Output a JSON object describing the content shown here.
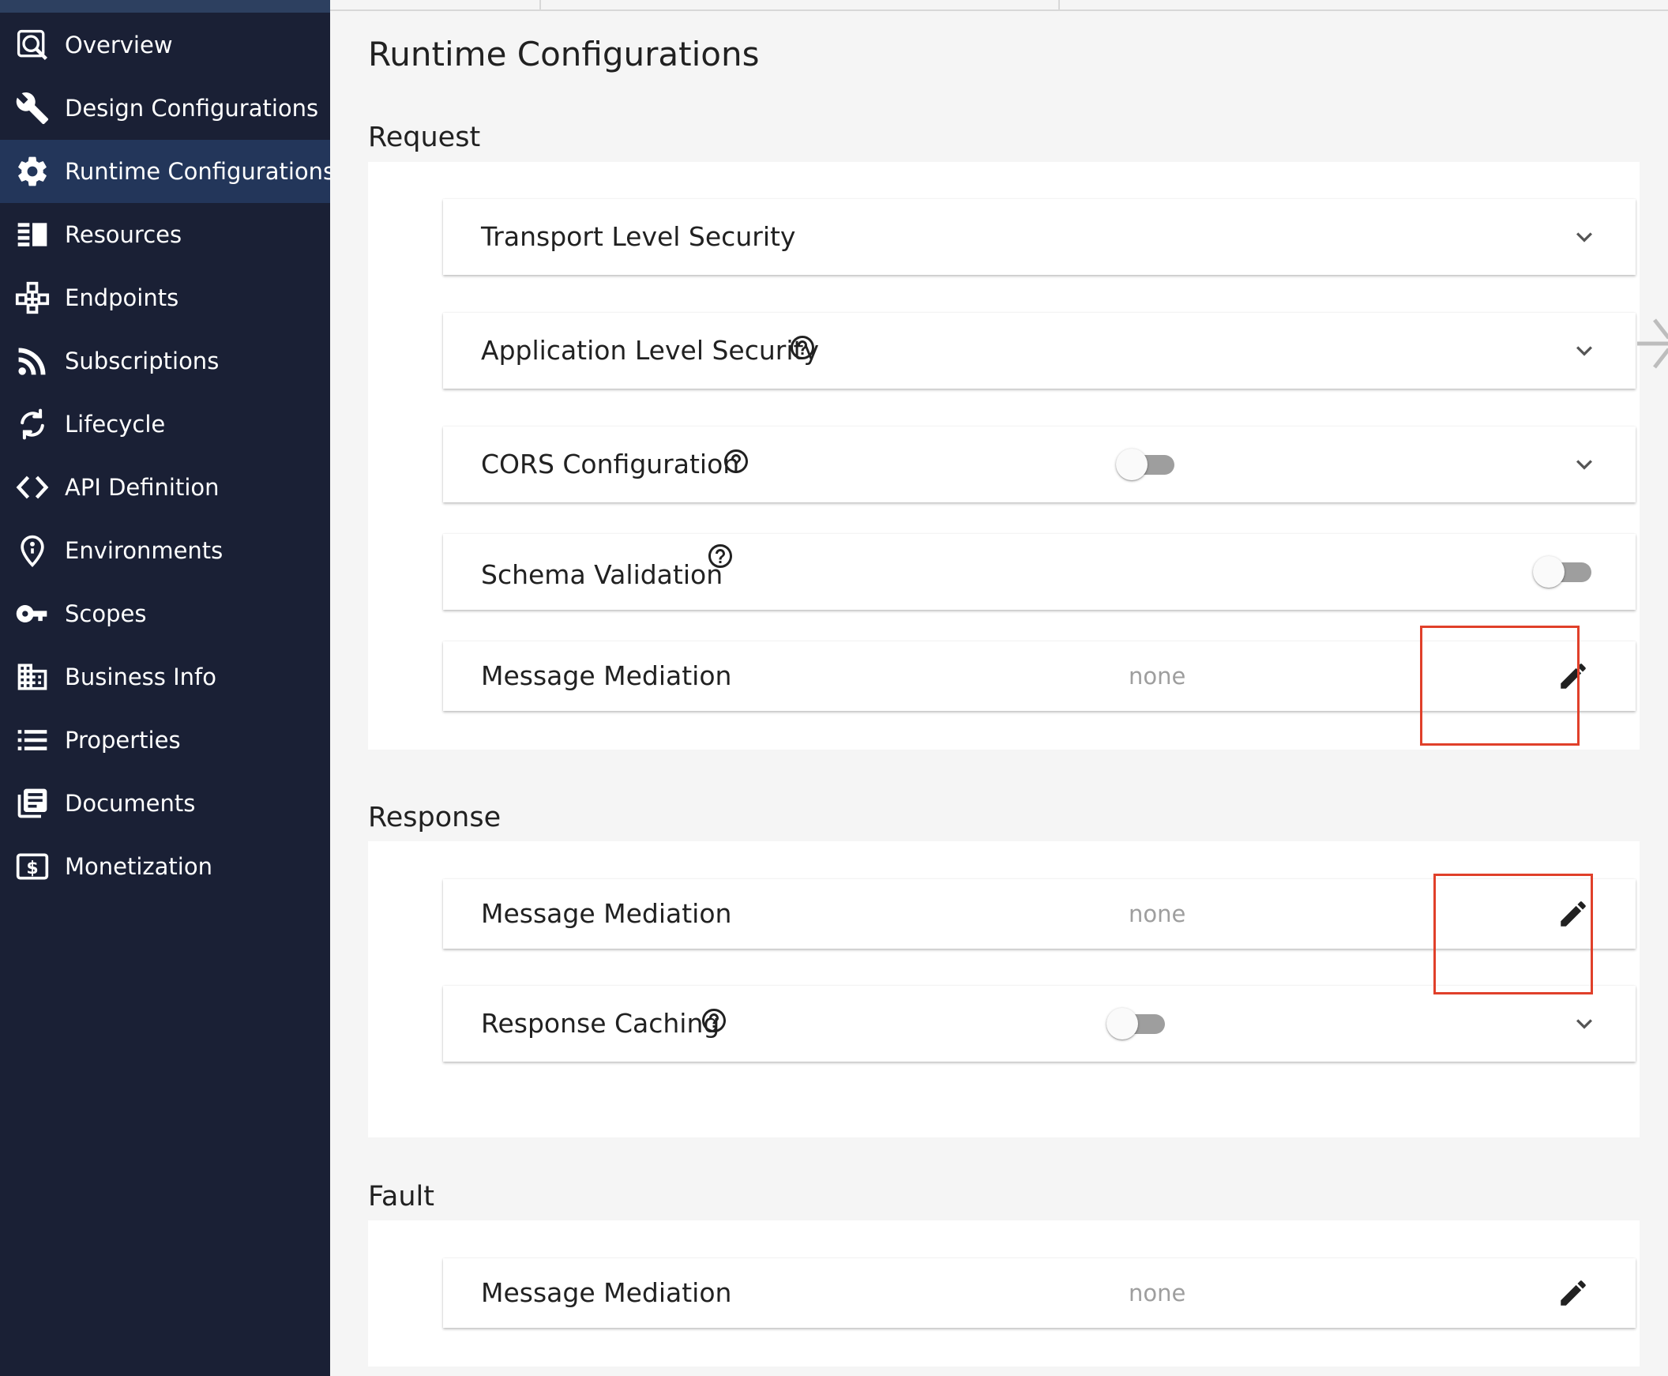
{
  "sidebar": {
    "items": [
      {
        "label": "Overview",
        "icon": "overview-search-icon"
      },
      {
        "label": "Design Configurations",
        "icon": "wrench-icon"
      },
      {
        "label": "Runtime Configurations",
        "icon": "gear-icon",
        "active": true
      },
      {
        "label": "Resources",
        "icon": "resources-icon"
      },
      {
        "label": "Endpoints",
        "icon": "endpoints-icon"
      },
      {
        "label": "Subscriptions",
        "icon": "rss-icon"
      },
      {
        "label": "Lifecycle",
        "icon": "lifecycle-icon"
      },
      {
        "label": "API Definition",
        "icon": "code-icon"
      },
      {
        "label": "Environments",
        "icon": "location-pin-icon"
      },
      {
        "label": "Scopes",
        "icon": "key-icon"
      },
      {
        "label": "Business Info",
        "icon": "building-icon"
      },
      {
        "label": "Properties",
        "icon": "list-icon"
      },
      {
        "label": "Documents",
        "icon": "documents-icon"
      },
      {
        "label": "Monetization",
        "icon": "dollar-icon"
      }
    ]
  },
  "main": {
    "title": "Runtime Configurations",
    "request": {
      "title": "Request",
      "transport_security": "Transport Level Security",
      "application_security": "Application Level Security",
      "cors": "CORS Configuration",
      "cors_enabled": false,
      "schema_validation": "Schema Validation",
      "schema_validation_enabled": false,
      "message_mediation": "Message Mediation",
      "message_mediation_value": "none"
    },
    "response": {
      "title": "Response",
      "message_mediation": "Message Mediation",
      "message_mediation_value": "none",
      "response_caching": "Response Caching",
      "response_caching_enabled": false
    },
    "fault": {
      "title": "Fault",
      "message_mediation": "Message Mediation",
      "message_mediation_value": "none"
    }
  },
  "colors": {
    "sidebar_bg": "#1a2035",
    "sidebar_active": "#23365a",
    "highlight": "#e0402a",
    "muted_text": "#9e9e9e"
  }
}
